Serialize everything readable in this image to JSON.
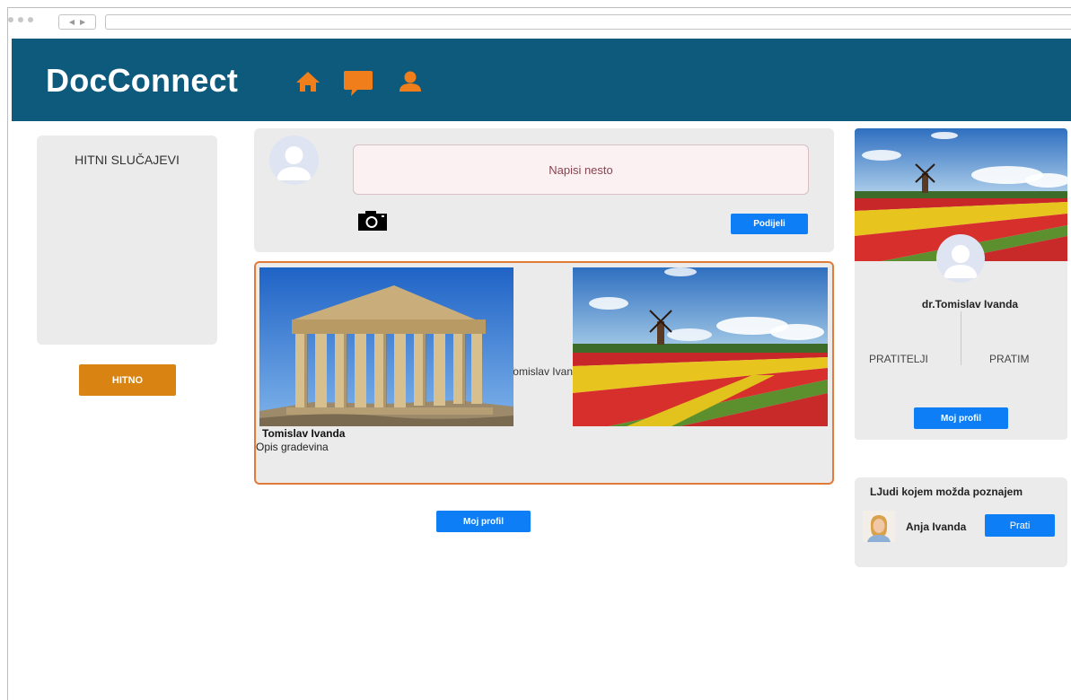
{
  "app": {
    "title": "DocConnect",
    "brand_color": "#0e5a7d",
    "accent_orange": "#f07f1b",
    "button_blue": "#0d7ef5"
  },
  "nav": {
    "icons": [
      "home-icon",
      "chat-icon",
      "user-icon"
    ]
  },
  "left_panel": {
    "title": "HITNI SLUČAJEVI",
    "button_label": "HITNO"
  },
  "compose": {
    "placeholder": "Napisi nesto",
    "share_label": "Podijeli"
  },
  "post": {
    "author": "Tomislav Ivanda",
    "description": "Opis gradevina",
    "overflow_author": "Tomislav Ivan"
  },
  "center": {
    "profile_button_label": "Moj profil"
  },
  "profile_card": {
    "name": "dr.Tomislav Ivanda",
    "followers_label": "PRATITELJI",
    "following_label": "PRATIM",
    "button_label": "Moj profil"
  },
  "suggestions": {
    "title": "LJudi kojem možda poznajem",
    "items": [
      {
        "name": "Anja Ivanda",
        "follow_label": "Prati"
      }
    ]
  }
}
